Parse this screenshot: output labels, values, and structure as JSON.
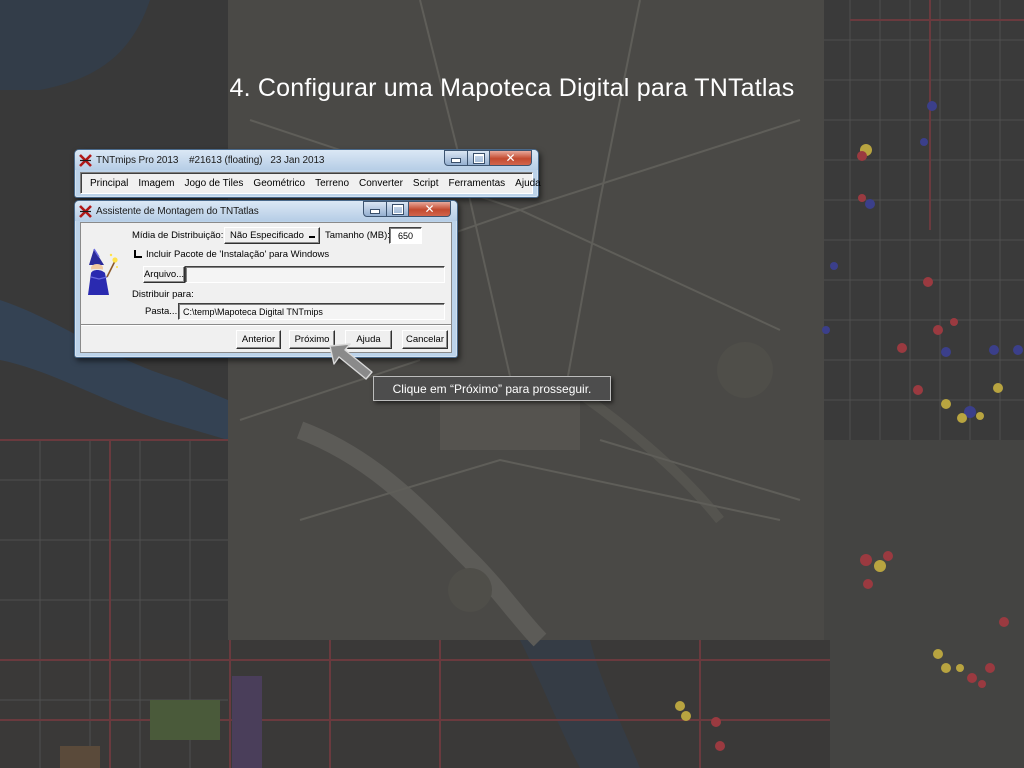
{
  "slide": {
    "title": "4. Configurar uma Mapoteca Digital para TNTatlas"
  },
  "main_window": {
    "title": "TNTmips Pro 2013    #21613 (floating)   23 Jan 2013",
    "icon": "tntmips-app-icon",
    "menu": [
      "Principal",
      "Imagem",
      "Jogo de Tiles",
      "Geométrico",
      "Terreno",
      "Converter",
      "Script",
      "Ferramentas",
      "Ajuda"
    ]
  },
  "wizard": {
    "title": "Assistente de Montagem do TNTatlas",
    "icon": "tntmips-app-icon",
    "media_label": "Mídia de Distribuição:",
    "media_value": "Não Especificado",
    "size_label": "Tamanho (MB):",
    "size_value": "650",
    "include_package_label": "Incluir Pacote de 'Instalação' para Windows",
    "include_package_checked": false,
    "file_button": "Arquivo...",
    "file_value": "",
    "distribute_label": "Distribuir para:",
    "folder_button": "Pasta...",
    "folder_value": "C:\\temp\\Mapoteca Digital TNTmips",
    "buttons": {
      "back": "Anterior",
      "next": "Próximo",
      "help": "Ajuda",
      "cancel": "Cancelar"
    },
    "mascot": "wizard-mascot-icon"
  },
  "callout": {
    "text": "Clique em “Próximo” para prosseguir."
  },
  "colors": {
    "title_bar": "#bcd3ea",
    "close_button": "#c34a30",
    "dialog_face": "#f0f0f0",
    "callout_bg": "#4d4d4d",
    "arrow_fill": "#8a8a8a"
  }
}
